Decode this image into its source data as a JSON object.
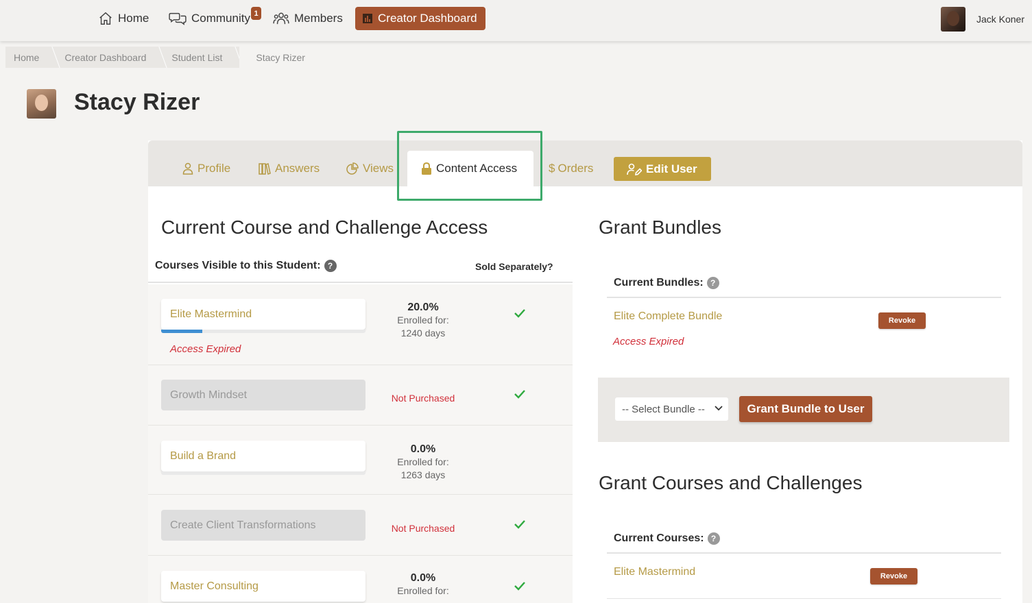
{
  "nav": {
    "home": "Home",
    "community": "Community",
    "community_badge": "1",
    "members": "Members",
    "creator_dashboard": "Creator Dashboard",
    "user_name": "Jack Koner"
  },
  "breadcrumb": [
    "Home",
    "Creator Dashboard",
    "Student List",
    "Stacy Rizer"
  ],
  "page_title": "Stacy Rizer",
  "tabs": {
    "profile": "Profile",
    "answers": "Answers",
    "views": "Views",
    "content_access": "Content Access",
    "orders": "Orders",
    "edit_user": "Edit User"
  },
  "left": {
    "title": "Current Course and Challenge Access",
    "courses_label": "Courses Visible to this Student:",
    "help": "?",
    "sold_label": "Sold Separately?",
    "courses": [
      {
        "name": "Elite Mastermind",
        "percent": "20.0%",
        "enrolled_label": "Enrolled for:",
        "days": "1240 days",
        "expired": "Access Expired",
        "sold_separately": true
      },
      {
        "name": "Growth Mindset",
        "status": "Not Purchased",
        "sold_separately": true
      },
      {
        "name": "Build a Brand",
        "percent": "0.0%",
        "enrolled_label": "Enrolled for:",
        "days": "1263 days",
        "sold_separately": false
      },
      {
        "name": "Create Client Transformations",
        "status": "Not Purchased",
        "sold_separately": true
      },
      {
        "name": "Master Consulting",
        "percent": "0.0%",
        "enrolled_label": "Enrolled for:",
        "sold_separately": true
      }
    ]
  },
  "right": {
    "bundles_title": "Grant Bundles",
    "current_bundles_label": "Current Bundles:",
    "bundle_name": "Elite Complete Bundle",
    "bundle_expired": "Access Expired",
    "revoke": "Revoke",
    "select_placeholder": "-- Select Bundle --",
    "grant_bundle": "Grant Bundle to User",
    "courses_title": "Grant Courses and Challenges",
    "current_courses_label": "Current Courses:",
    "course_name": "Elite Mastermind"
  },
  "colors": {
    "accent": "#b59a46",
    "brand": "#a5532f",
    "expired": "#d1303a",
    "check": "#2faa3f",
    "highlight": "#3eaa6b"
  }
}
